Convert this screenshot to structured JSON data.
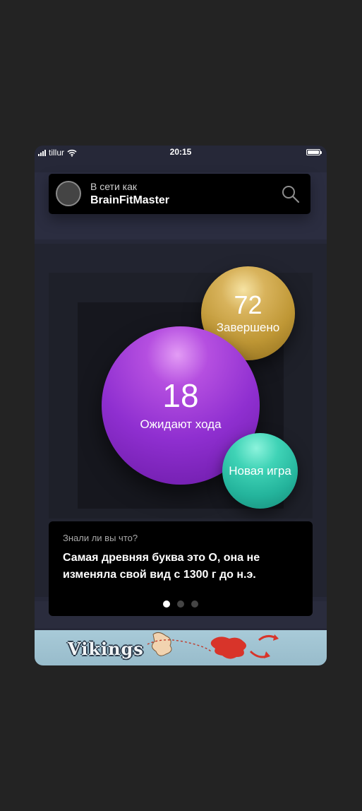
{
  "status_bar": {
    "carrier": "tillur",
    "time": "20:15"
  },
  "header": {
    "online_label": "В сети как",
    "username": "BrainFitMaster"
  },
  "stats": {
    "completed": {
      "count": "72",
      "label": "Завершено"
    },
    "waiting": {
      "count": "18",
      "label": "Ожидают хода"
    },
    "new_game": {
      "label": "Новая игра"
    }
  },
  "fact": {
    "title": "Знали ли вы что?",
    "text": "Самая древняя буква это О, она не изменяла свой вид с 1300 г до н.э.",
    "pages": 3,
    "active_page": 1
  },
  "ad": {
    "title": "Vikings"
  },
  "colors": {
    "background": "#232323",
    "phone": "#262838",
    "card": "#000000",
    "gold": "#c9a043",
    "purple": "#9a36d6",
    "teal": "#2cc4a8"
  },
  "icons": {
    "search": "search-icon",
    "wifi": "wifi-icon",
    "signal": "signal-icon",
    "battery": "battery-icon"
  }
}
